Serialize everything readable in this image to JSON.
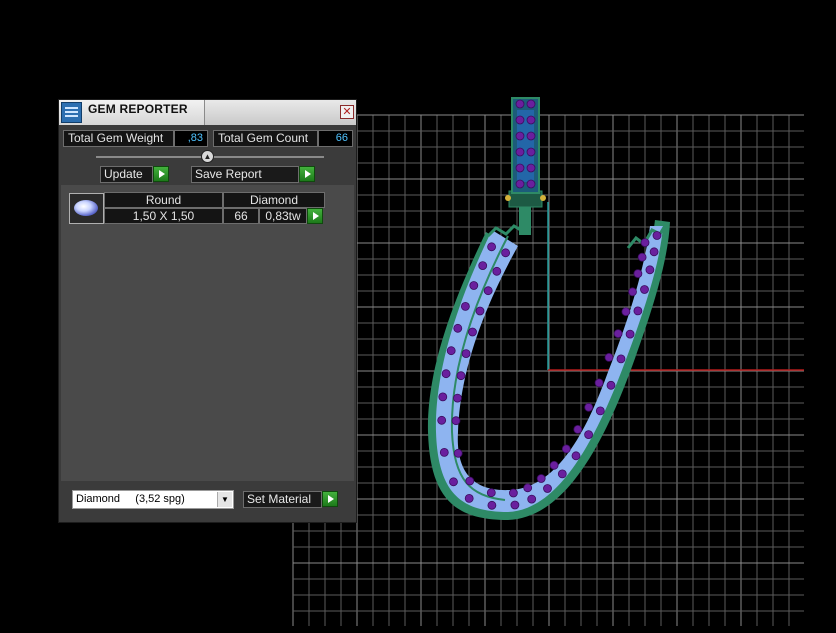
{
  "panel": {
    "title": "GEM REPORTER",
    "close_symbol": "✕",
    "total_gem_weight_label": "Total Gem Weight",
    "total_gem_weight_value": ",83",
    "total_gem_count_label": "Total Gem Count",
    "total_gem_count_value": "66",
    "update_label": "Update",
    "save_report_label": "Save Report",
    "table": {
      "shape": "Round",
      "material": "Diamond",
      "size": "1,50 X 1,50",
      "count": "66",
      "weight": "0,83tw"
    },
    "material_select": {
      "value": "Diamond     (3,52 spg)"
    },
    "set_material_label": "Set Material"
  },
  "icons": {
    "app": "gem-reporter-icon",
    "close": "close-icon",
    "collapse": "collapse-arrow-icon",
    "play": "green-play-icon",
    "gem": "round-gem-icon",
    "dropdown": "chevron-down-icon"
  },
  "colors": {
    "grid_line": "#5c5c5c",
    "x_axis": "#b31a1a",
    "y_axis": "#1f9a9a",
    "band_fill": "#8eb4f0",
    "band_border": "#2e8a66",
    "gem_color": "#6a1f9e",
    "value_text": "#4fc3ff",
    "play_green": "#2e9a2a"
  }
}
